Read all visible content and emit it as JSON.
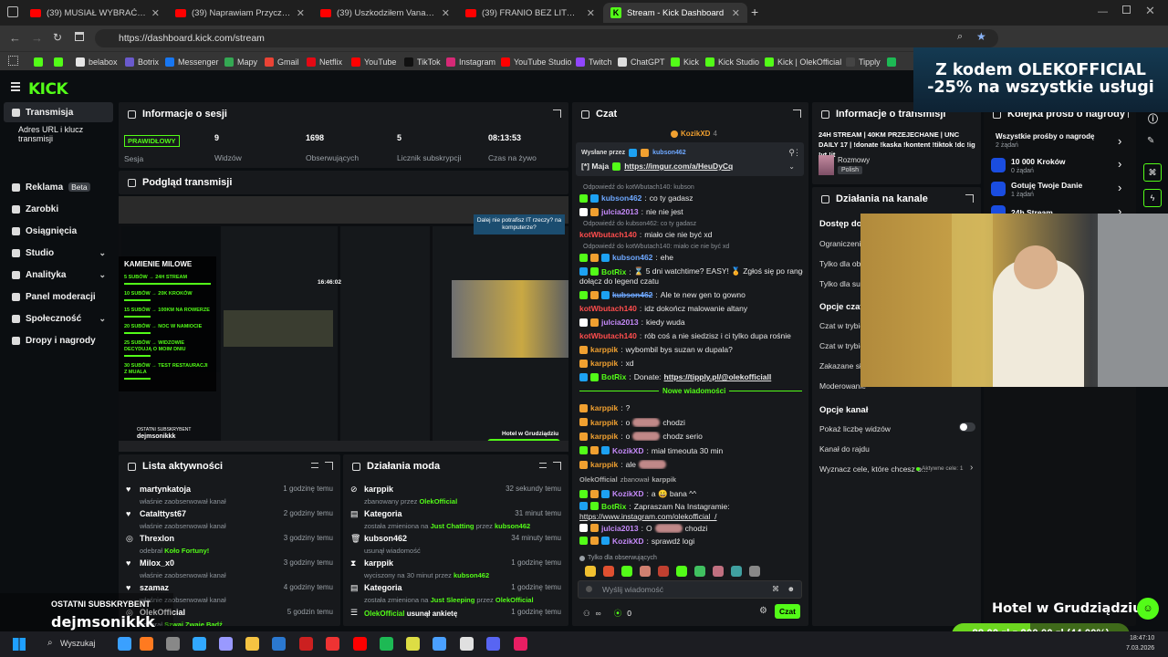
{
  "browser": {
    "tabs": [
      {
        "label": "(39) MUSIAŁ WYBRAĆ KOGO U...",
        "icon": "youtube-icon",
        "active": false
      },
      {
        "label": "(39) Naprawiam Przyczepę Kem...",
        "icon": "youtube-icon",
        "active": false
      },
      {
        "label": "(39) Uszkodziłem Vana o Słup B...",
        "icon": "youtube-icon",
        "active": false
      },
      {
        "label": "(39) FRANIO BEZ LITOŚCI NAD...",
        "icon": "youtube-icon",
        "active": false
      },
      {
        "label": "Stream - Kick Dashboard",
        "icon": "kick-icon",
        "active": true
      }
    ],
    "new_tab": "+",
    "url": "https://dashboard.kick.com/stream",
    "bookmarks": [
      {
        "label": "",
        "color": "#53fc18"
      },
      {
        "label": "",
        "color": "#53fc18"
      },
      {
        "label": "belabox",
        "color": "#e5e5e5"
      },
      {
        "label": "Botrix",
        "color": "#6a5acd"
      },
      {
        "label": "Messenger",
        "color": "#1877f2"
      },
      {
        "label": "Mapy",
        "color": "#34a853"
      },
      {
        "label": "Gmail",
        "color": "#ea4335"
      },
      {
        "label": "Netflix",
        "color": "#e50914"
      },
      {
        "label": "YouTube",
        "color": "#ff0000"
      },
      {
        "label": "TikTok",
        "color": "#111111"
      },
      {
        "label": "Instagram",
        "color": "#d62976"
      },
      {
        "label": "YouTube Studio",
        "color": "#ff0000"
      },
      {
        "label": "Twitch",
        "color": "#9146ff"
      },
      {
        "label": "ChatGPT",
        "color": "#dddddd"
      },
      {
        "label": "Kick",
        "color": "#53fc18"
      },
      {
        "label": "Kick Studio",
        "color": "#53fc18"
      },
      {
        "label": "Kick | OlekOfficial",
        "color": "#53fc18"
      },
      {
        "label": "Tipply",
        "color": "#444444"
      },
      {
        "label": "",
        "color": "#1db954"
      }
    ]
  },
  "kick": {
    "logo": "KICK"
  },
  "sidebar": {
    "items": [
      {
        "label": "Transmisja",
        "active": true
      },
      {
        "label": "Adres URL i klucz transmisji",
        "sub": true
      },
      {
        "label": "Reklama",
        "badge": "Beta"
      },
      {
        "label": "Zarobki"
      },
      {
        "label": "Osiągnięcia"
      },
      {
        "label": "Studio",
        "chevron": true
      },
      {
        "label": "Analityka",
        "chevron": true
      },
      {
        "label": "Panel moderacji"
      },
      {
        "label": "Społeczność",
        "chevron": true
      },
      {
        "label": "Dropy i nagrody"
      }
    ]
  },
  "session": {
    "title": "Informacje o sesji",
    "badge": "PRAWIDŁOWY",
    "stats": [
      {
        "label": "Sesja",
        "value": ""
      },
      {
        "label": "Widzów",
        "value": "9"
      },
      {
        "label": "Obserwujących",
        "value": "1698"
      },
      {
        "label": "Licznik subskrypcji",
        "value": "5"
      },
      {
        "label": "Czas na żywo",
        "value": "08:13:53"
      }
    ]
  },
  "preview": {
    "title": "Podgląd transmisji",
    "milestones_title": "KAMIENIE MILOWE",
    "milestones": [
      "5 SUBÓW → 24H STREAM",
      "10 SUBÓW → 20K KROKÓW",
      "15 SUBÓW → 100KM NA ROWERZE",
      "20 SUBÓW → NOC W NAMIOCIE",
      "25 SUBÓW → WIDZOWIE DECYDUJĄ O MOIM DNIU",
      "30 SUBÓW → TEST RESTAURACJI Z MUALA"
    ],
    "promo_text": "Dalej nie potrafisz IT rzeczy? na komputerze?",
    "last_sub_label": "OSTATNI SUBSKRYBENT",
    "last_sub": "dejmsonikkk",
    "city": "Hotel w Grudziądziu",
    "clock": "16:46:02"
  },
  "activity": {
    "title": "Lista aktywności",
    "items": [
      {
        "name": "martynkatoja",
        "sub": "właśnie zaobserwował kanał",
        "time": "1 godzinę temu",
        "icon": "heart-icon"
      },
      {
        "name": "Catalttyst67",
        "sub": "właśnie zaobserwował kanał",
        "time": "2 godziny temu",
        "icon": "heart-icon"
      },
      {
        "name": "Threxlon",
        "sub": "odebrał",
        "sub_accent": "Koło Fortuny!",
        "time": "3 godziny temu",
        "icon": "wheel-icon"
      },
      {
        "name": "Milox_x0",
        "sub": "właśnie zaobserwował kanał",
        "time": "3 godziny temu",
        "icon": "heart-icon"
      },
      {
        "name": "szamaz",
        "sub": "właśnie zaobserwował kanał",
        "time": "4 godziny temu",
        "icon": "heart-icon"
      },
      {
        "name": "OlekOfficial",
        "sub": "odebrał",
        "sub_accent": "Szwaj Zwaje Bądź",
        "time": "5 godzin temu",
        "icon": "wheel-icon"
      }
    ]
  },
  "modactions": {
    "title": "Działania moda",
    "items": [
      {
        "name": "karppik",
        "pre": "zbanowany przez",
        "accent": "OlekOfficial",
        "time": "32 sekundy temu",
        "icon": "ban-icon"
      },
      {
        "name": "Kategoria",
        "pre": "została zmieniona na",
        "accent": "Just Chatting",
        "mid": "przez",
        "accent2": "kubson462",
        "time": "31 minut temu",
        "icon": "category-icon"
      },
      {
        "name": "kubson462",
        "pre": "usunął wiadomość",
        "time": "34 minuty temu",
        "icon": "trash-icon"
      },
      {
        "name": "karppik",
        "pre": "wyciszony na 30 minut przez",
        "accent": "kubson462",
        "time": "1 godzinę temu",
        "icon": "timer-icon"
      },
      {
        "name": "Kategoria",
        "pre": "została zmieniona na",
        "accent": "Just Sleeping",
        "mid": "przez",
        "accent2": "OlekOfficial",
        "time": "1 godzinę temu",
        "icon": "category-icon"
      },
      {
        "name": "OlekOfficial",
        "pre": "usunął ankietę",
        "time": "1 godzinę temu",
        "icon": "poll-icon",
        "name_accent": true
      }
    ]
  },
  "chat": {
    "title": "Czat",
    "pinned_top": "KozikXD",
    "pinned_top_count": "4",
    "pinned_by_label": "Wysłane przez",
    "pinned_by": "kubson462",
    "pinned_user": "[*] Maja",
    "pinned_link": "https://imgur.com/a/HeuDyCq",
    "messages": [
      {
        "reply": "Odpowiedź do kotWbutach140: kubson",
        "user": "kubson462",
        "color": "#6ea8ff",
        "text": "co ty gadasz",
        "badges": [
          "#53fc18",
          "#1da1f2"
        ]
      },
      {
        "user": "julcia2013",
        "color": "#c58af9",
        "text": "nie nie jest",
        "badges": [
          "#ffffff",
          "#f0a030"
        ]
      },
      {
        "reply": "Odpowiedź do kubson462: co ty gadasz",
        "user": "kotWbutach140",
        "color": "#ff4d4d",
        "text": "miało cie nie być xd",
        "badges": []
      },
      {
        "reply": "Odpowiedź do kotWbutach140: miało cie nie być xd",
        "user": "kubson462",
        "color": "#6ea8ff",
        "text": "ehe",
        "badges": [
          "#53fc18",
          "#f0a030",
          "#1da1f2"
        ]
      },
      {
        "user": "BotRix",
        "color": "#53fc18",
        "text": "⌛ 5 dni watchtime? EASY! 🏅 Zgłoś się po rangę OG i",
        "text2": "dołącz do legend czatu",
        "badges": [
          "#1da1f2",
          "#53fc18"
        ]
      },
      {
        "user": "kubson462",
        "color": "#6ea8ff",
        "text": "Ale te new gen to gowno",
        "badges": [
          "#53fc18",
          "#f0a030",
          "#1da1f2"
        ],
        "strike": true
      },
      {
        "user": "kotWbutach140",
        "color": "#ff4d4d",
        "text": "idz dokończ malowanie altany",
        "badges": []
      },
      {
        "user": "julcia2013",
        "color": "#c58af9",
        "text": "kiedy wuda",
        "badges": [
          "#ffffff",
          "#f0a030"
        ]
      },
      {
        "user": "kotWbutach140",
        "color": "#ff4d4d",
        "text": "rób coś a nie siedzisz i ci tylko dupa rośnie",
        "badges": []
      },
      {
        "user": "karppik",
        "color": "#f0a030",
        "text": "wybombil bys suzan w dupala?",
        "badges": [
          "#f0a030"
        ]
      },
      {
        "user": "karppik",
        "color": "#f0a030",
        "text": "xd",
        "badges": [
          "#f0a030"
        ]
      },
      {
        "user": "BotRix",
        "color": "#53fc18",
        "text": "Donate:",
        "link": "https://tipply.pl/@olekofficiall",
        "badges": [
          "#1da1f2",
          "#53fc18"
        ]
      }
    ],
    "new_messages_label": "Nowe wiadomości",
    "messages2": [
      {
        "user": "karppik",
        "color": "#f0a030",
        "text": "?",
        "badges": [
          "#f0a030"
        ]
      },
      {
        "user": "karppik",
        "color": "#f0a030",
        "text": "o",
        "blur": true,
        "text2": "chodzi",
        "badges": [
          "#f0a030"
        ]
      },
      {
        "user": "karppik",
        "color": "#f0a030",
        "text": "o",
        "blur": true,
        "text2": "chodz serio",
        "badges": [
          "#f0a030"
        ]
      },
      {
        "user": "KozikXD",
        "color": "#c58af9",
        "text": "miał timeouta 30 min",
        "badges": [
          "#53fc18",
          "#f0a030",
          "#1da1f2"
        ]
      },
      {
        "user": "karppik",
        "color": "#f0a030",
        "text": "ale",
        "blur": true,
        "text2": "",
        "badges": [
          "#f0a030"
        ]
      }
    ],
    "ban_notice_user": "OlekOfficial",
    "ban_notice_text": "zbanował",
    "ban_notice_target": "karppik",
    "messages3": [
      {
        "user": "KozikXD",
        "color": "#c58af9",
        "text": "a 😀 bana ^^",
        "badges": [
          "#53fc18",
          "#f0a030",
          "#1da1f2"
        ]
      },
      {
        "user": "BotRix",
        "color": "#53fc18",
        "text": "Zapraszam Na Instagramie:",
        "link2": "https://www.instagram.com/olekofficial_/",
        "badges": [
          "#1da1f2",
          "#53fc18"
        ]
      },
      {
        "user": "julcia2013",
        "color": "#c58af9",
        "text": "O",
        "blur": true,
        "text2": "chodzi",
        "badges": [
          "#ffffff",
          "#f0a030"
        ]
      },
      {
        "user": "KozikXD",
        "color": "#c58af9",
        "text": "sprawdź logi",
        "badges": [
          "#53fc18",
          "#f0a030",
          "#1da1f2"
        ]
      }
    ],
    "followers_only": "Tylko dla obserwujących",
    "input_placeholder": "Wyślij wiadomość",
    "send": "Czat",
    "viewers_small": "0"
  },
  "streaminfo": {
    "title": "Informacje o transmisji",
    "stream_title": "24H STREAM | 40KM PRZEJECHANE | UNC DAILY 17 | !donate !kaska !kontent !tiktok !dc !ig !yt !it",
    "category": "Rozmowy",
    "language": "Polish"
  },
  "channel": {
    "title": "Działania na kanale",
    "access": "Dostęp do c",
    "rows1": [
      "Ograniczenie c",
      "Tylko dla obse",
      "Tylko dla subs"
    ],
    "opts_title": "Opcje czatu",
    "rows2": [
      "Czat w trybie",
      "Czat w trybie",
      "Zakazane słow",
      "Moderowanie"
    ],
    "channel_opts": "Opcje kanał",
    "show_viewers": "Pokaż liczbę widzów",
    "raid": "Kanał do rajdu",
    "goals": "Wyznacz cele, które chcesz o...",
    "goals_active": "Aktywne cele: 1"
  },
  "rewards": {
    "title": "Kolejka próśb o nagrody",
    "all_label": "Wszystkie prośby o nagrodę",
    "all_count": "2 żądań",
    "items": [
      {
        "name": "10 000 Kroków",
        "count": "0 żądań"
      },
      {
        "name": "Gotuję Twoje Danie",
        "count": "1 żądań"
      },
      {
        "name": "24h Stream",
        "count": ""
      }
    ]
  },
  "overlay": {
    "promo": "Z kodem OLEKOFFICIAL -25% na wszystkie usługi",
    "city": "Hotel w Grudziądziu",
    "goal": "88,00 zł z 200,00 zł (44,00%)",
    "goal_progress": 0.44,
    "last_sub_label": "OSTATNI SUBSKRYBENT",
    "last_sub": "dejmsonikkk"
  },
  "taskbar": {
    "search": "Wyszukaj",
    "time": "18:47:10",
    "date": "7.03.2026"
  }
}
